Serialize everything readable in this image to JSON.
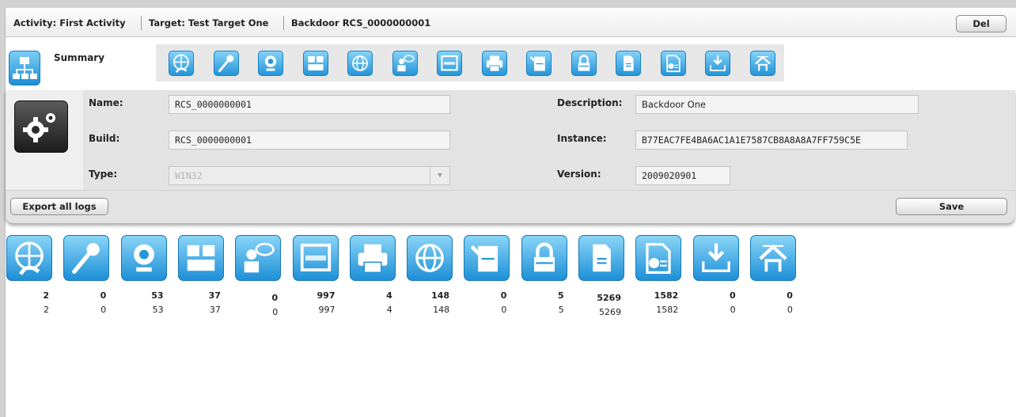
{
  "header": {
    "activity": "Activity: First Activity",
    "target": "Target: Test Target One",
    "backdoor": "Backdoor RCS_0000000001",
    "del_label": "Del"
  },
  "summary": {
    "label": "Summary",
    "tabs": [
      "phone-icon",
      "microphone-icon",
      "webcam-icon",
      "keylog-icon",
      "url-icon",
      "chat-icon",
      "screenshot-icon",
      "print-icon",
      "clipboard-icon",
      "password-icon",
      "file-icon",
      "file-capture-icon",
      "download-icon",
      "upload-icon"
    ]
  },
  "form": {
    "name_label": "Name:",
    "name_value": "RCS_0000000001",
    "build_label": "Build:",
    "build_value": "RCS_0000000001",
    "type_label": "Type:",
    "type_value": "WIN32",
    "description_label": "Description:",
    "description_value": "Backdoor One",
    "instance_label": "Instance:",
    "instance_value": "B77EAC7FE4BA6AC1A1E7587CB8A8A8A7FF759C5E",
    "version_label": "Version:",
    "version_value": "2009020901"
  },
  "actions": {
    "export_label": "Export all logs",
    "save_label": "Save"
  },
  "evidence": [
    {
      "icon": "phone-icon",
      "total": "2",
      "current": "2"
    },
    {
      "icon": "microphone-icon",
      "total": "0",
      "current": "0"
    },
    {
      "icon": "webcam-icon",
      "total": "53",
      "current": "53"
    },
    {
      "icon": "keylog-icon",
      "total": "37",
      "current": "37"
    },
    {
      "icon": "chat-icon",
      "total": "0",
      "current": "0"
    },
    {
      "icon": "screenshot-icon",
      "total": "997",
      "current": "997"
    },
    {
      "icon": "print-icon",
      "total": "4",
      "current": "4"
    },
    {
      "icon": "url-icon",
      "total": "148",
      "current": "148"
    },
    {
      "icon": "clipboard-icon",
      "total": "0",
      "current": "0"
    },
    {
      "icon": "password-icon",
      "total": "5",
      "current": "5"
    },
    {
      "icon": "file-icon",
      "total": "5269",
      "current": "5269"
    },
    {
      "icon": "file-capture-icon",
      "total": "1582",
      "current": "1582"
    },
    {
      "icon": "download-icon",
      "total": "0",
      "current": "0"
    },
    {
      "icon": "upload-icon",
      "total": "0",
      "current": "0"
    }
  ],
  "colors": {
    "accent": "#2595d8",
    "accent_light": "#84d2f7",
    "panel": "#e3e3e3"
  }
}
